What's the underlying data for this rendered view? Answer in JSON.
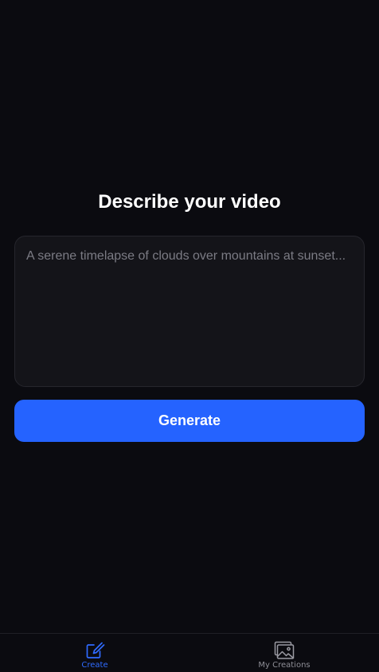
{
  "main": {
    "title": "Describe your video",
    "prompt_placeholder": "A serene timelapse of clouds over mountains at sunset...",
    "prompt_value": "",
    "generate_label": "Generate"
  },
  "tabbar": {
    "tabs": [
      {
        "label": "Create",
        "icon": "edit-icon",
        "active": true
      },
      {
        "label": "My Creations",
        "icon": "gallery-icon",
        "active": false
      }
    ]
  },
  "colors": {
    "background": "#0b0b10",
    "accent": "#2563ff",
    "input_bg": "#141419",
    "inactive": "#8e8e96"
  }
}
